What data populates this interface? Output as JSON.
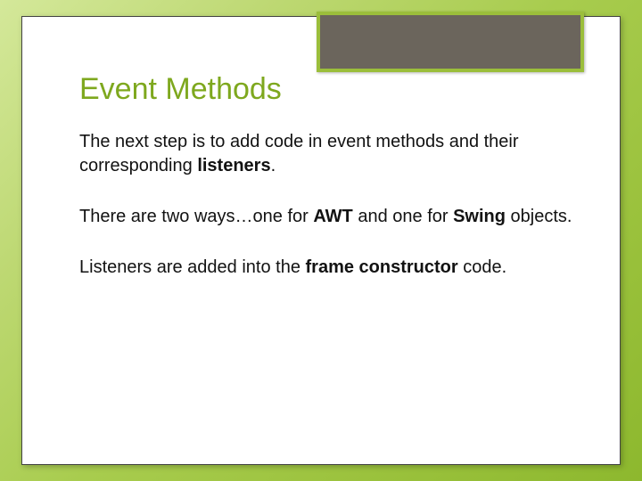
{
  "title": "Event Methods",
  "p1_a": "The next step is to add code in event methods and their corresponding ",
  "p1_b": "listeners",
  "p1_c": ".",
  "p2_a": "There are two ways…one for ",
  "p2_b": "AWT",
  "p2_c": " and one for ",
  "p2_d": "Swing",
  "p2_e": " objects.",
  "p3_a": "Listeners are added into the ",
  "p3_b": "frame constructor",
  "p3_c": " code."
}
